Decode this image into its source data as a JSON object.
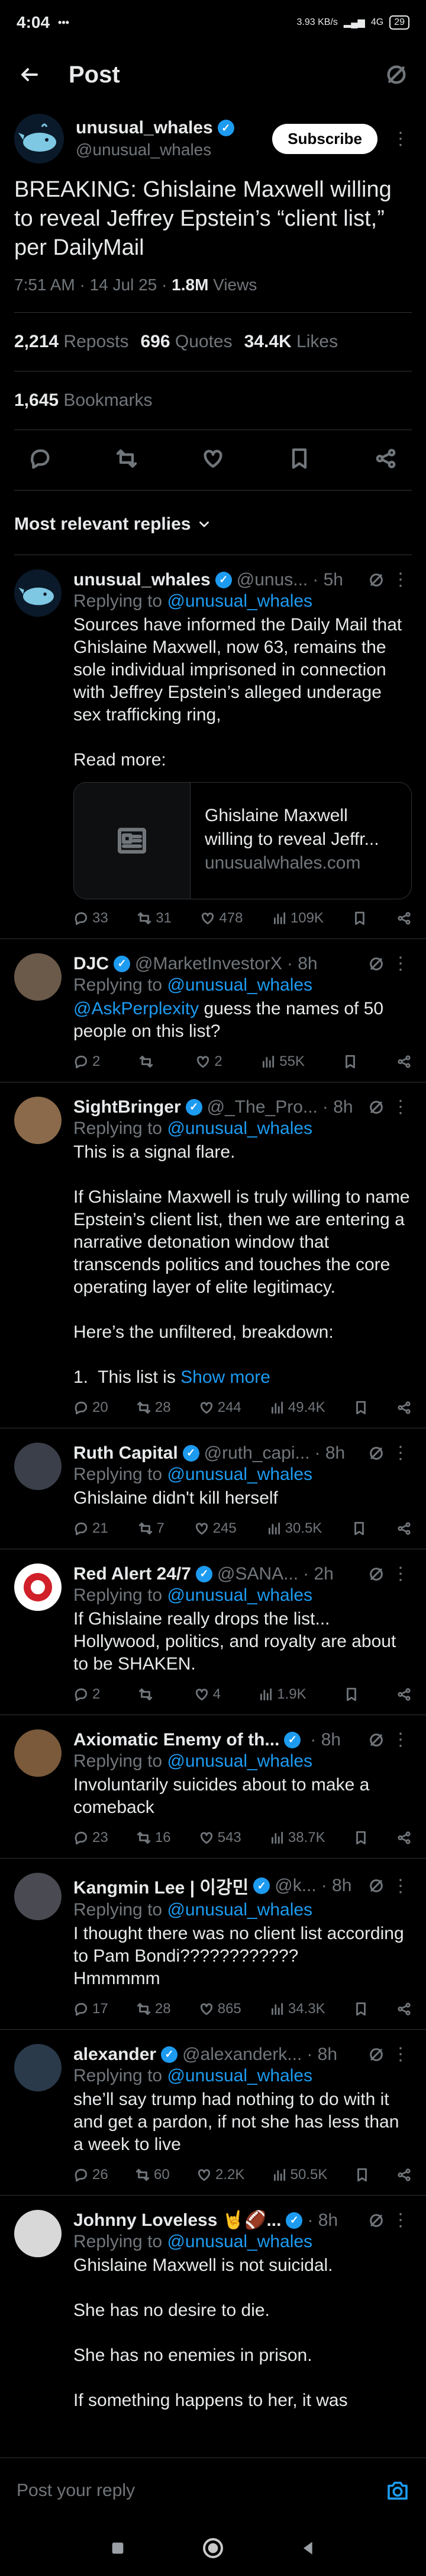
{
  "status_bar": {
    "time": "4:04",
    "dots": "•••",
    "net_speed": "3.93 KB/s",
    "network": "4G",
    "battery": "29"
  },
  "header": {
    "title": "Post"
  },
  "post": {
    "display_name": "unusual_whales",
    "handle": "@unusual_whales",
    "subscribe_label": "Subscribe",
    "text": "BREAKING: Ghislaine Maxwell willing to reveal Jeffrey Epstein’s “client list,” per DailyMail",
    "datetime": "7:51 AM · 14 Jul 25 · ",
    "views_count": "1.8M",
    "views_label": " Views",
    "reposts_count": "2,214",
    "reposts_label": "Reposts",
    "quotes_count": "696",
    "quotes_label": "Quotes",
    "likes_count": "34.4K",
    "likes_label": "Likes",
    "bookmarks_count": "1,645",
    "bookmarks_label": "Bookmarks"
  },
  "sort_label": "Most relevant replies",
  "replies": [
    {
      "name": "unusual_whales",
      "handle": "@unus...",
      "time": "· 5h",
      "replying_prefix": "Replying to ",
      "replying_to": "@unusual_whales",
      "text": "Sources have informed the Daily Mail that Ghislaine Maxwell, now 63, remains the sole individual imprisoned in connection with Jeffrey Epstein’s alleged underage sex trafficking ring,\n\nRead more:",
      "card_title": "Ghislaine Maxwell willing to reveal Jeffr...",
      "card_domain": "unusualwhales.com",
      "replies": "33",
      "reposts": "31",
      "likes": "478",
      "views": "109K"
    },
    {
      "name": "DJC",
      "handle": "@MarketInvestorX",
      "time": "· 8h",
      "replying_prefix": "Replying to ",
      "replying_to": "@unusual_whales",
      "mention": "@AskPerplexity",
      "text": " guess the names of 50 people on this list?",
      "replies": "2",
      "reposts": "",
      "likes": "2",
      "views": "55K"
    },
    {
      "name": "SightBringer",
      "handle": "@_The_Pro...",
      "time": "· 8h",
      "replying_prefix": "Replying to ",
      "replying_to": "@unusual_whales",
      "text": "This is a signal flare.\n\nIf Ghislaine Maxwell is truly willing to name Epstein’s client list, then we are entering a narrative detonation window that transcends politics and touches the core operating layer of elite legitimacy.\n\nHere’s the unfiltered, breakdown:\n\n1.  This list is ",
      "show_more": "Show more",
      "replies": "20",
      "reposts": "28",
      "likes": "244",
      "views": "49.4K"
    },
    {
      "name": "Ruth Capital",
      "handle": "@ruth_capi...",
      "time": "· 8h",
      "replying_prefix": "Replying to ",
      "replying_to": "@unusual_whales",
      "text": "Ghislaine didn't kill herself",
      "replies": "21",
      "reposts": "7",
      "likes": "245",
      "views": "30.5K"
    },
    {
      "name": "Red Alert 24/7",
      "handle": "@SANA...",
      "time": "· 2h",
      "replying_prefix": "Replying to ",
      "replying_to": "@unusual_whales",
      "text": "If Ghislaine really drops the list... Hollywood, politics, and royalty are about to be SHAKEN.",
      "replies": "2",
      "reposts": "",
      "likes": "4",
      "views": "1.9K"
    },
    {
      "name": "Axiomatic Enemy of th...",
      "handle": "",
      "time": "· 8h",
      "replying_prefix": "Replying to ",
      "replying_to": "@unusual_whales",
      "text": "Involuntarily suicides about to make a comeback",
      "replies": "23",
      "reposts": "16",
      "likes": "543",
      "views": "38.7K"
    },
    {
      "name": "Kangmin Lee | 이강민",
      "handle": "@k...",
      "time": "· 8h",
      "replying_prefix": "Replying to ",
      "replying_to": "@unusual_whales",
      "text": "I thought there was no client list according to Pam Bondi????????????\nHmmmmm",
      "replies": "17",
      "reposts": "28",
      "likes": "865",
      "views": "34.3K"
    },
    {
      "name": "alexander",
      "handle": "@alexanderk...",
      "time": "· 8h",
      "replying_prefix": "Replying to ",
      "replying_to": "@unusual_whales",
      "text": "she’ll say trump had nothing to do with it and get a pardon, if not she has less than a week to live",
      "replies": "26",
      "reposts": "60",
      "likes": "2.2K",
      "views": "50.5K"
    },
    {
      "name": "Johnny Loveless 🤘🏈...",
      "handle": "",
      "time": "· 8h",
      "replying_prefix": "Replying to ",
      "replying_to": "@unusual_whales",
      "text": "Ghislaine Maxwell is not suicidal.\n\nShe has no desire to die.\n\nShe has no enemies in prison.\n\nIf something happens to her, it was",
      "replies": "",
      "reposts": "",
      "likes": "",
      "views": ""
    }
  ],
  "composer": {
    "placeholder": "Post your reply"
  },
  "colors": {
    "accent": "#1d9bf0",
    "background": "#000000",
    "text": "#e7e9ea",
    "muted": "#71767b",
    "divider": "#2f3336"
  }
}
